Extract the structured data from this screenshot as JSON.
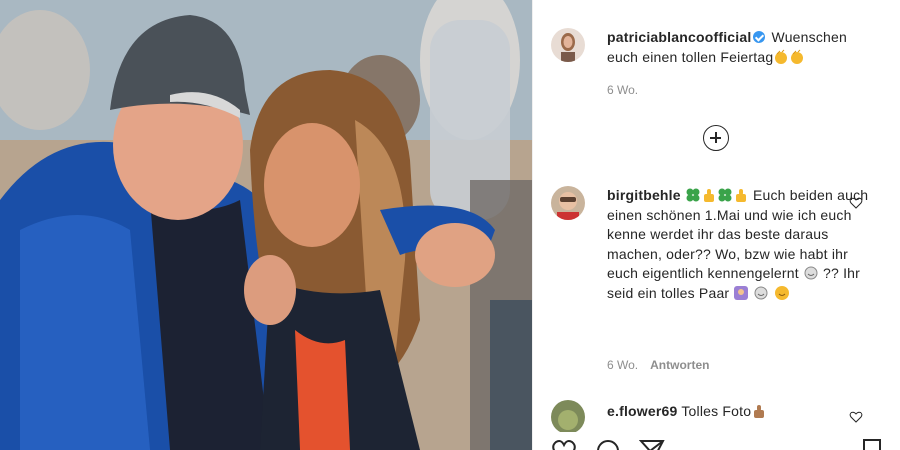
{
  "post": {
    "caption": {
      "username": "patriciablancoofficial",
      "text_before": "Wuenschen euch einen tollen Feiertag",
      "time": "6 Wo."
    },
    "load_more_icon": "plus-circle-icon",
    "comments": [
      {
        "username": "birgitbehle",
        "text_1": " Euch",
        "text_2": "beiden auch einen schönen 1.Mai und wie ich euch kenne werdet ihr das beste daraus machen, oder?? Wo, bzw wie habt ihr euch eigentlich kennengelernt",
        "text_3": " ?? Ihr seid ein tolles Paar ",
        "time": "6 Wo.",
        "reply": "Antworten"
      },
      {
        "username": "e.flower69",
        "text": "Tolles Foto"
      }
    ]
  },
  "actions": [
    "heart-icon",
    "comment-icon",
    "share-icon",
    "bookmark-icon"
  ],
  "colors": {
    "verified": "#3897f0",
    "meta": "#8e8e8e",
    "text": "#262626"
  }
}
